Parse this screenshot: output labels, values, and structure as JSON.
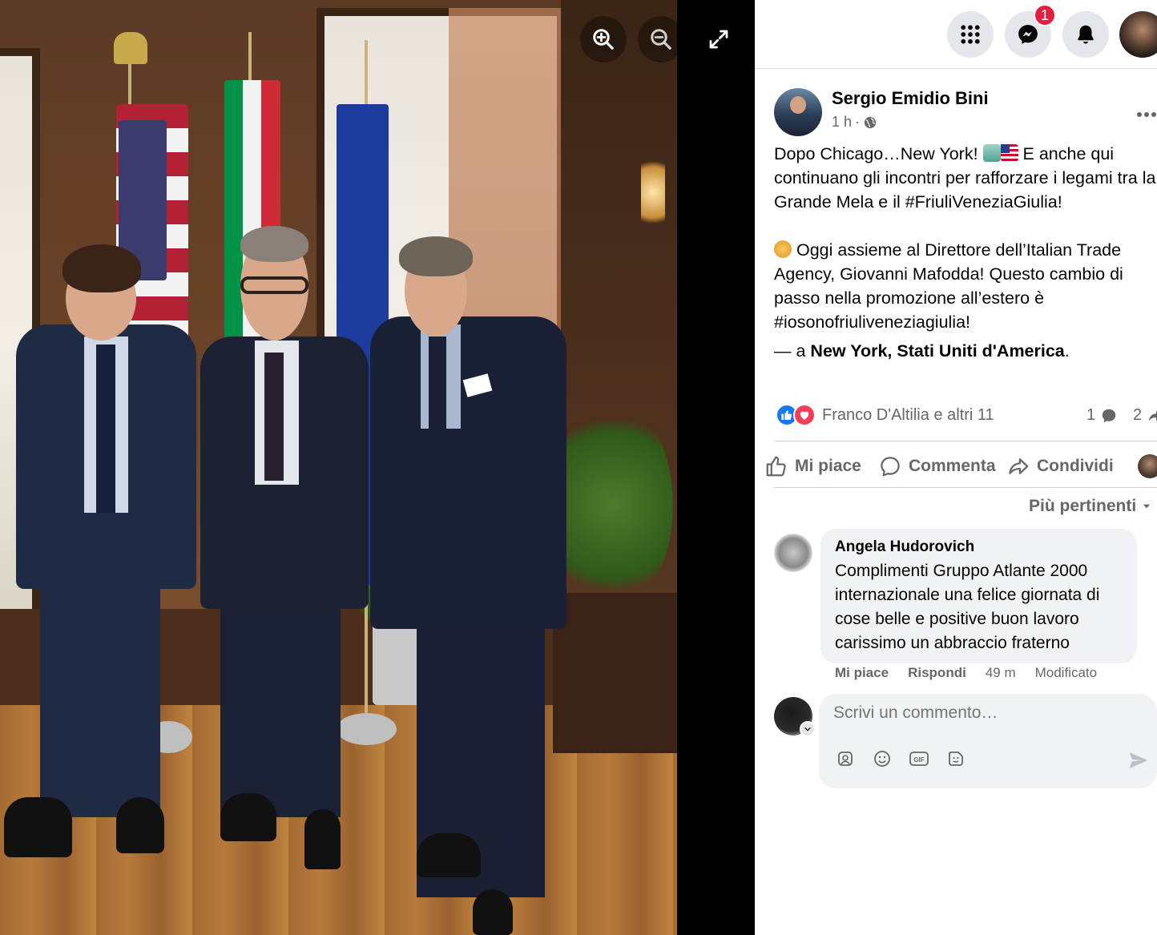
{
  "topbar": {
    "menu_icon": "grid-menu-icon",
    "messenger_icon": "messenger-icon",
    "messenger_badge": "1",
    "notifications_icon": "bell-icon"
  },
  "viewer": {
    "zoom_in_icon": "zoom-in-icon",
    "zoom_out_icon": "zoom-out-icon",
    "fullscreen_icon": "fullscreen-icon"
  },
  "post": {
    "author": "Sergio Emidio Bini",
    "time": "1 h",
    "privacy_icon": "globe-icon",
    "text_line1_a": "Dopo Chicago…New York!",
    "text_line1_b": "E anche qui continuano gli incontri per rafforzare i legami tra la Grande Mela e il #FriuliVeneziaGiulia!",
    "text_para2": "Oggi assieme al Direttore dell’Italian Trade Agency, Giovanni Mafodda! Questo cambio di passo nella promozione all’estero è #iosonofriuliveneziagiulia!",
    "location_prefix": "— a",
    "location": "New York, Stati Uniti d'America",
    "location_suffix": "."
  },
  "engagement": {
    "reactions_names": "Franco D'Altilia e altri 11",
    "comments_count": "1",
    "shares_count": "2"
  },
  "actions": {
    "like": "Mi piace",
    "comment": "Commenta",
    "share": "Condividi"
  },
  "comments": {
    "sort_label": "Più pertinenti",
    "items": [
      {
        "author": "Angela Hudorovich",
        "text": "Complimenti Gruppo Atlante 2000 internazionale una felice giornata di cose belle e positive buon lavoro carissimo un abbraccio fraterno",
        "like": "Mi piace",
        "reply": "Rispondi",
        "time": "49 m",
        "edited": "Modificato"
      }
    ],
    "composer_placeholder": "Scrivi un commento…"
  },
  "colors": {
    "accent": "#1877f2",
    "love": "#f33e58",
    "badge": "#e41e3f",
    "secondary_text": "#65676b"
  }
}
